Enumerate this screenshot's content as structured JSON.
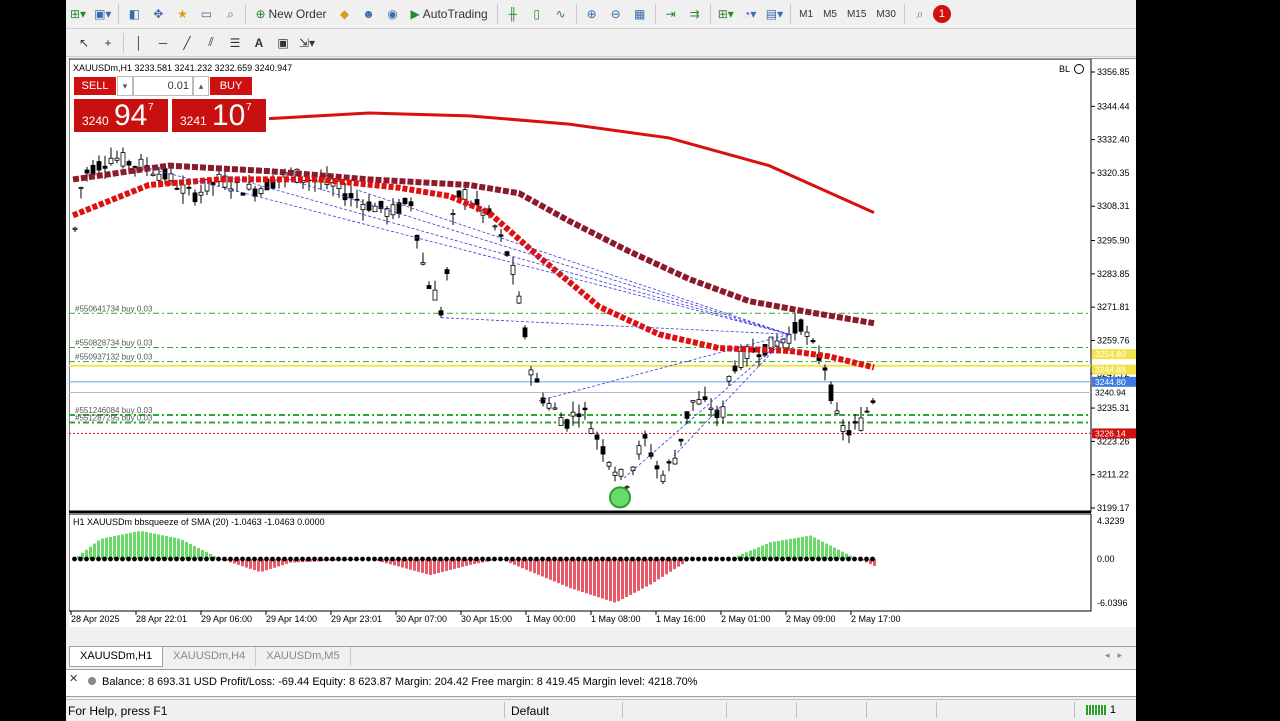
{
  "toolbar": {
    "new_order_label": "New Order",
    "autotrading_label": "AutoTrading",
    "timeframes": [
      "M1",
      "M5",
      "M15",
      "M30"
    ],
    "notification_count": "1",
    "accent": "#d01010"
  },
  "chart": {
    "header": "XAUUSDm,H1  3233.581 3241.232 3232.659 3240.947",
    "bl_label": "BL",
    "price_ticks": [
      "3356.85",
      "3344.44",
      "3332.40",
      "3320.35",
      "3308.31",
      "3295.90",
      "3283.85",
      "3271.81",
      "3259.76",
      "3247.72",
      "3235.31",
      "3223.26",
      "3211.22",
      "3199.17"
    ],
    "price_labels": {
      "line_1": "3254.80",
      "line_2": "3244.88",
      "line_3": "3244.80",
      "bid": "3240.94",
      "stop": "3226.14"
    },
    "orders": [
      {
        "label": "#550641734 buy 0.03",
        "level": 3269.6
      },
      {
        "label": "#550828734 buy 0.03",
        "level": 3257.2
      },
      {
        "label": "#550937132 buy 0.03",
        "level": 3252.1
      },
      {
        "label": "#551246084 buy 0.03",
        "level": 3232.8
      },
      {
        "label": "#551287295 buy 0.03",
        "level": 3230.1
      }
    ],
    "time_ticks": [
      "28 Apr 2025",
      "28 Apr 22:01",
      "29 Apr 06:00",
      "29 Apr 14:00",
      "29 Apr 23:01",
      "30 Apr 07:00",
      "30 Apr 15:00",
      "1 May 00:00",
      "1 May 08:00",
      "1 May 16:00",
      "2 May 01:00",
      "2 May 09:00",
      "2 May 17:00"
    ],
    "indicator": {
      "label": "H1 XAUUSDm bbsqueeze of SMA (20) -1.0463 -1.0463 0.0000",
      "ticks": [
        "4.3239",
        "0.00",
        "-6.0396"
      ]
    }
  },
  "trade_panel": {
    "sell_label": "SELL",
    "buy_label": "BUY",
    "lot": "0.01",
    "sell_price_prefix": "3240",
    "sell_price_big": "94",
    "sell_price_sup": "7",
    "buy_price_prefix": "3241",
    "buy_price_big": "10",
    "buy_price_sup": "7"
  },
  "tabs": [
    "XAUUSDm,H1",
    "XAUUSDm,H4",
    "XAUUSDm,M5"
  ],
  "terminal": {
    "line": "Balance: 8 693.31 USD  Profit/Loss: -69.44  Equity: 8 623.87  Margin: 204.42  Free margin: 8 419.45  Margin level: 4218.70%"
  },
  "status": {
    "help": "For Help, press F1",
    "profile": "Default",
    "connection": "1"
  }
}
